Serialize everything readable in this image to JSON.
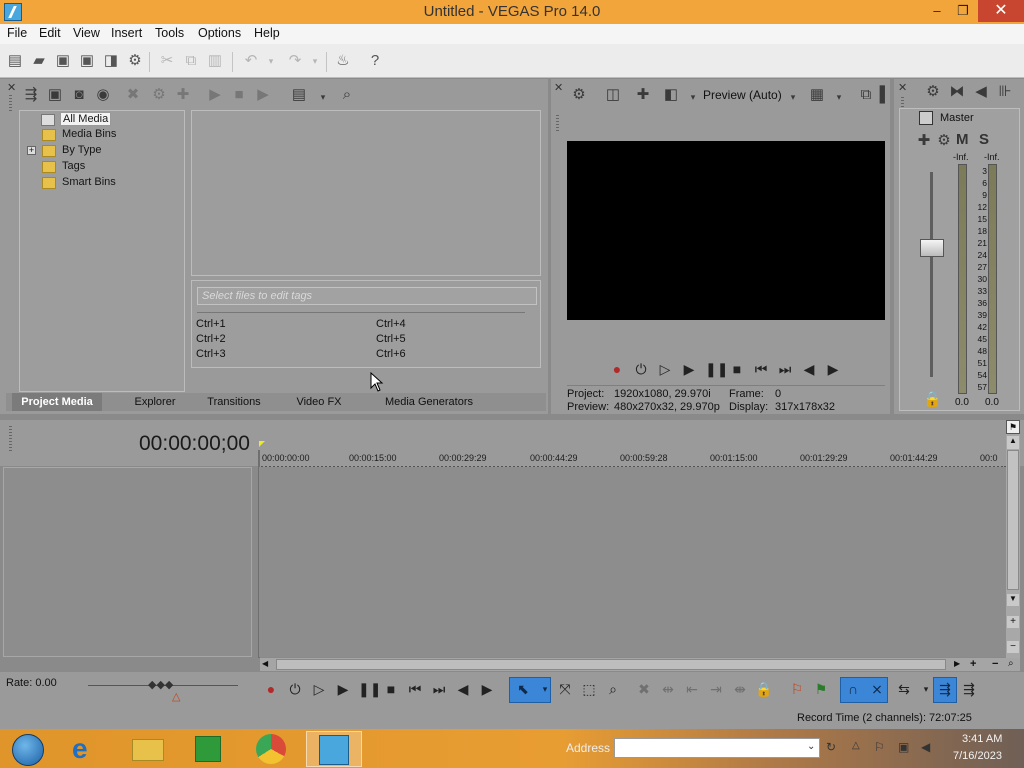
{
  "window": {
    "title": "Untitled - VEGAS Pro 14.0",
    "minimize": "–",
    "maximize": "❐",
    "close": "✕"
  },
  "menu": [
    "File",
    "Edit",
    "View",
    "Insert",
    "Tools",
    "Options",
    "Help"
  ],
  "toolbar_icons": [
    "new-project-icon",
    "open-icon",
    "save-icon",
    "save-as-icon",
    "render-icon",
    "properties-icon",
    "cut-icon",
    "copy-icon",
    "paste-icon",
    "undo-icon",
    "redo-icon",
    "burn-icon",
    "help-icon"
  ],
  "project_media": {
    "tree": [
      {
        "label": "All Media",
        "selected": true
      },
      {
        "label": "Media Bins"
      },
      {
        "label": "By Type",
        "expander": "+"
      },
      {
        "label": "Tags"
      },
      {
        "label": "Smart Bins"
      }
    ],
    "tag_placeholder": "Select files to edit tags",
    "shortcuts": [
      "Ctrl+1",
      "Ctrl+2",
      "Ctrl+3",
      "Ctrl+4",
      "Ctrl+5",
      "Ctrl+6"
    ],
    "tabs": [
      "Project Media",
      "Explorer",
      "Transitions",
      "Video FX",
      "Media Generators"
    ],
    "active_tab": "Project Media"
  },
  "preview": {
    "mode": "Preview (Auto)",
    "project_label": "Project:",
    "project_value": "1920x1080, 29.970i",
    "preview_label": "Preview:",
    "preview_value": "480x270x32, 29.970p",
    "frame_label": "Frame:",
    "frame_value": "0",
    "display_label": "Display:",
    "display_value": "317x178x32"
  },
  "master": {
    "title": "Master",
    "m": "M",
    "s": "S",
    "inf_left": "-Inf.",
    "inf_right": "-Inf.",
    "scale": [
      "3",
      "6",
      "9",
      "12",
      "15",
      "18",
      "21",
      "24",
      "27",
      "30",
      "33",
      "36",
      "39",
      "42",
      "45",
      "48",
      "51",
      "54",
      "57"
    ],
    "value_left": "0.0",
    "value_right": "0.0"
  },
  "timeline": {
    "timecode": "00:00:00;00",
    "ruler": [
      "00:00:00:00",
      "00:00:15:00",
      "00:00:29:29",
      "00:00:44:29",
      "00:00:59:28",
      "00:01:15:00",
      "00:01:29:29",
      "00:01:44:29",
      "00:0"
    ],
    "rate": "Rate: 0.00",
    "record_time": "Record Time (2 channels): 72:07:25"
  },
  "taskbar": {
    "address_label": "Address",
    "time": "3:41 AM",
    "date": "7/16/2023"
  },
  "colors": {
    "titlebar": "#f2a53a",
    "close": "#c8462f",
    "panel": "#9a9a9a",
    "active_tool": "#3b86d6"
  }
}
